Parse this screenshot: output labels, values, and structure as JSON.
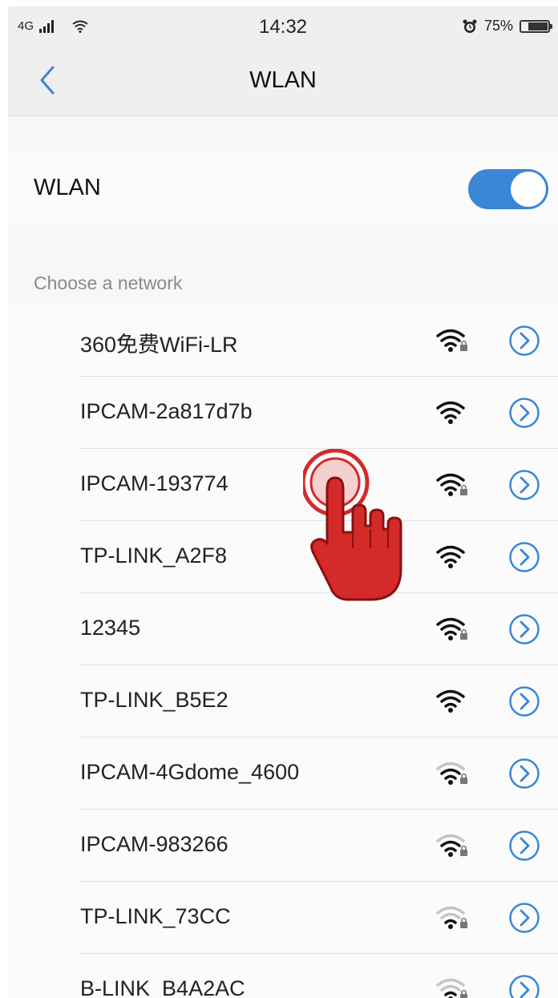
{
  "status_bar": {
    "network": "4G",
    "time": "14:32",
    "battery_percent": "75%",
    "battery_level": 0.75,
    "icons": [
      "signal-bars-icon",
      "wifi-status-icon",
      "alarm-icon",
      "battery-icon"
    ]
  },
  "nav": {
    "title": "WLAN",
    "back_icon": "chevron-left-icon"
  },
  "wlan_toggle": {
    "label": "WLAN",
    "enabled": true
  },
  "section_header": "Choose a network",
  "networks": [
    {
      "name": "360免费WiFi-LR",
      "secured": true,
      "signal": 4
    },
    {
      "name": "IPCAM-2a817d7b",
      "secured": false,
      "signal": 4
    },
    {
      "name": "IPCAM-193774",
      "secured": true,
      "signal": 4
    },
    {
      "name": "TP-LINK_A2F8",
      "secured": false,
      "signal": 4
    },
    {
      "name": "12345",
      "secured": true,
      "signal": 4
    },
    {
      "name": "TP-LINK_B5E2",
      "secured": false,
      "signal": 4
    },
    {
      "name": "IPCAM-4Gdome_4600",
      "secured": true,
      "signal": 3
    },
    {
      "name": "IPCAM-983266",
      "secured": true,
      "signal": 3
    },
    {
      "name": "TP-LINK_73CC",
      "secured": true,
      "signal": 2
    },
    {
      "name": "B-LINK_B4A2AC",
      "secured": true,
      "signal": 2
    }
  ],
  "colors": {
    "accent": "#3b86d6",
    "tap_hand": "#d42a2a"
  },
  "overlay": {
    "icon": "tap-hand-icon",
    "target": "IPCAM-193774"
  }
}
